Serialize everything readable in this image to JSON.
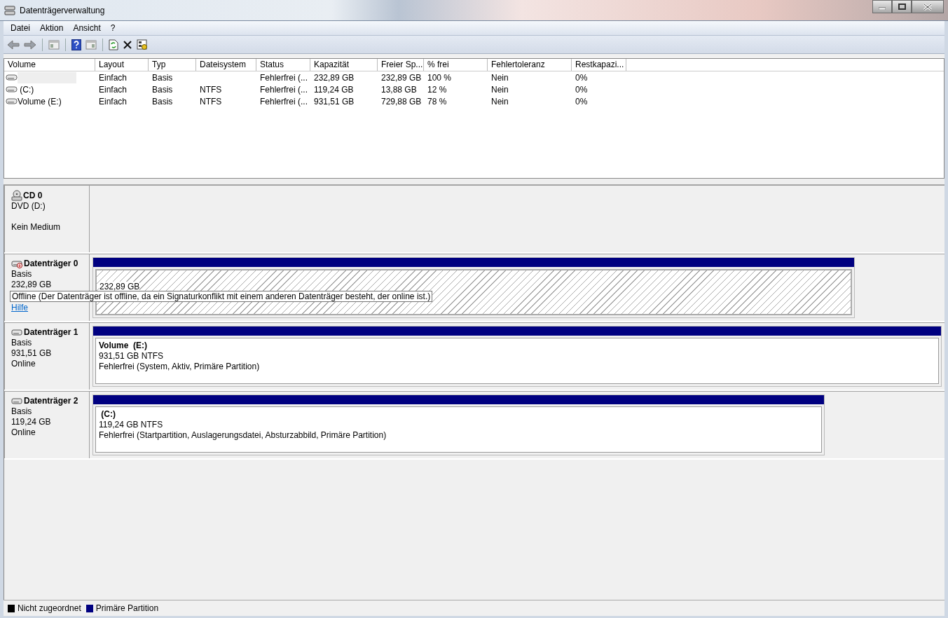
{
  "window": {
    "title": "Datenträgerverwaltung"
  },
  "menu": [
    {
      "label": "Datei"
    },
    {
      "label": "Aktion"
    },
    {
      "label": "Ansicht"
    },
    {
      "label": "?"
    }
  ],
  "table": {
    "columns": [
      "Volume",
      "Layout",
      "Typ",
      "Dateisystem",
      "Status",
      "Kapazität",
      "Freier Sp...",
      "% frei",
      "Fehlertoleranz",
      "Restkapazi..."
    ],
    "rows": [
      {
        "selected": true,
        "cells": [
          null,
          "Einfach",
          "Basis",
          null,
          "Fehlerfrei (...",
          "232,89 GB",
          "232,89 GB",
          "100 %",
          "Nein",
          "0%"
        ]
      },
      {
        "selected": false,
        "cells": [
          " (C:)",
          "Einfach",
          "Basis",
          "NTFS",
          "Fehlerfrei (...",
          "119,24 GB",
          "13,88 GB",
          "12 %",
          "Nein",
          "0%"
        ]
      },
      {
        "selected": false,
        "cells": [
          "Volume (E:)",
          "Einfach",
          "Basis",
          "NTFS",
          "Fehlerfrei (...",
          "931,51 GB",
          "729,88 GB",
          "78 %",
          "Nein",
          "0%"
        ]
      }
    ]
  },
  "disks": [
    {
      "kind": "cd",
      "name": "CD 0",
      "type": "DVD (D:)",
      "status": "Kein Medium"
    },
    {
      "kind": "offline",
      "name": "Datenträger 0",
      "type": "Basis",
      "size": "232,89 GB",
      "help_link": "Hilfe",
      "tooltip": "Offline (Der Datenträger ist offline, da ein Signaturkonflikt mit einem anderen Datenträger besteht, der online ist.)",
      "partition": {
        "kind": "offline",
        "size": "232,89 GB"
      }
    },
    {
      "kind": "online",
      "name": "Datenträger 1",
      "type": "Basis",
      "size": "931,51 GB",
      "status": "Online",
      "partition": {
        "kind": "primary",
        "name": "Volume  (E:)",
        "size": "931,51 GB NTFS",
        "status": "Fehlerfrei (System, Aktiv, Primäre Partition)"
      }
    },
    {
      "kind": "online",
      "name": "Datenträger 2",
      "type": "Basis",
      "size": "119,24 GB",
      "status": "Online",
      "partition": {
        "kind": "primary",
        "name": " (C:)",
        "size": "119,24 GB NTFS",
        "status": "Fehlerfrei (Startpartition, Auslagerungsdatei, Absturzabbild, Primäre Partition)"
      }
    }
  ],
  "legend": [
    {
      "label": "Nicht zugeordnet",
      "color": "#000000"
    },
    {
      "label": "Primäre Partition",
      "color": "#000080"
    }
  ]
}
